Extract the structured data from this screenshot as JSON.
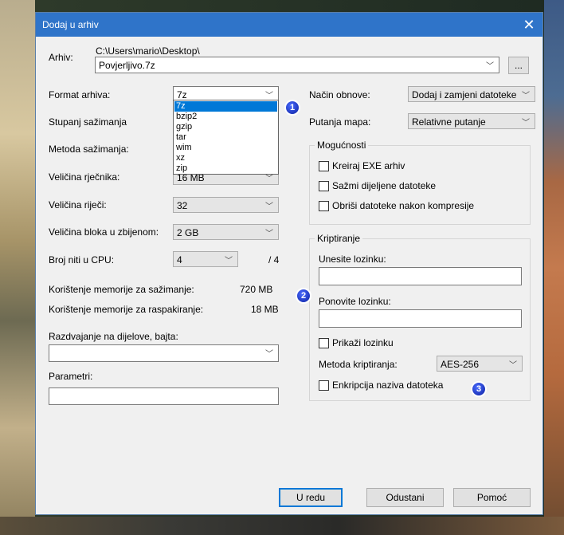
{
  "window": {
    "title": "Dodaj u arhiv"
  },
  "archive": {
    "label": "Arhiv:",
    "path": "C:\\Users\\mario\\Desktop\\",
    "filename": "Povjerljivo.7z",
    "browse_label": "..."
  },
  "left": {
    "format_label": "Format arhiva:",
    "format_value": "7z",
    "format_options": [
      "7z",
      "bzip2",
      "gzip",
      "tar",
      "wim",
      "xz",
      "zip"
    ],
    "level_label": "Stupanj sažimanja",
    "method_label": "Metoda sažimanja:",
    "dict_label": "Veličina rječnika:",
    "dict_value": "16 MB",
    "word_label": "Veličina riječi:",
    "word_value": "32",
    "block_label": "Veličina bloka u zbijenom:",
    "block_value": "2 GB",
    "threads_label": "Broj niti u CPU:",
    "threads_value": "4",
    "threads_total": "/ 4",
    "mem_compress_label": "Korištenje memorije za sažimanje:",
    "mem_compress_value": "720 MB",
    "mem_decompress_label": "Korištenje memorije za raspakiranje:",
    "mem_decompress_value": "18 MB",
    "split_label": "Razdvajanje na dijelove, bajta:",
    "split_value": "",
    "params_label": "Parametri:",
    "params_value": ""
  },
  "right": {
    "update_label": "Način obnove:",
    "update_value": "Dodaj i zamjeni datoteke",
    "paths_label": "Putanja mapa:",
    "paths_value": "Relativne putanje",
    "options_title": "Mogućnosti",
    "opt_sfx": "Kreiraj EXE arhiv",
    "opt_shared": "Sažmi dijeljene datoteke",
    "opt_delete": "Obriši datoteke nakon kompresije",
    "enc_title": "Kriptiranje",
    "enc_pw_label": "Unesite lozinku:",
    "enc_pw2_label": "Ponovite lozinku:",
    "enc_show": "Prikaži lozinku",
    "enc_method_label": "Metoda kriptiranja:",
    "enc_method_value": "AES-256",
    "enc_names": "Enkripcija naziva datoteka"
  },
  "buttons": {
    "ok": "U redu",
    "cancel": "Odustani",
    "help": "Pomoć"
  },
  "badges": [
    "1",
    "2",
    "3"
  ]
}
